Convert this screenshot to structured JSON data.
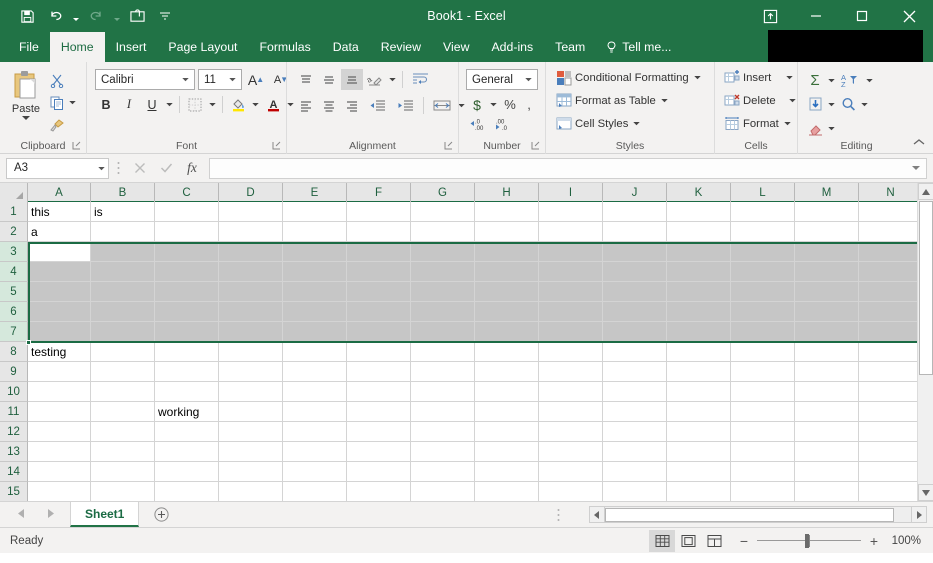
{
  "window": {
    "title": "Book1 - Excel",
    "controls": {
      "ribbon_display_options": "ribbon-display-options",
      "minimize": "minimize",
      "maximize": "maximize",
      "close": "close"
    }
  },
  "quick_access": {
    "items": [
      {
        "name": "save",
        "icon": "save-icon"
      },
      {
        "name": "undo",
        "icon": "undo-icon",
        "has_caret": true
      },
      {
        "name": "redo",
        "icon": "redo-icon",
        "has_caret": true,
        "disabled": true
      },
      {
        "name": "touch-mode",
        "icon": "touch-mode-icon"
      },
      {
        "name": "customize-quick-access-toolbar",
        "icon": "chevron-down-icon"
      }
    ]
  },
  "ribbon": {
    "tabs": [
      {
        "label": "File",
        "active": false
      },
      {
        "label": "Home",
        "active": true
      },
      {
        "label": "Insert",
        "active": false
      },
      {
        "label": "Page Layout",
        "active": false
      },
      {
        "label": "Formulas",
        "active": false
      },
      {
        "label": "Data",
        "active": false
      },
      {
        "label": "Review",
        "active": false
      },
      {
        "label": "View",
        "active": false
      },
      {
        "label": "Add-ins",
        "active": false
      },
      {
        "label": "Team",
        "active": false
      }
    ],
    "tell_me": "Tell me...",
    "groups": {
      "clipboard": {
        "label": "Clipboard",
        "paste_label": "Paste",
        "cut_label": "Cut",
        "copy_label": "Copy",
        "format_painter_label": "Format Painter"
      },
      "font": {
        "label": "Font",
        "font_name": "Calibri",
        "font_size": "11",
        "bold": "B",
        "italic": "I",
        "underline": "U",
        "increase_size": "A",
        "decrease_size": "A"
      },
      "alignment": {
        "label": "Alignment"
      },
      "number": {
        "label": "Number",
        "format": "General",
        "currency": "$",
        "percent": "%",
        "comma": ","
      },
      "styles": {
        "label": "Styles",
        "items": [
          {
            "label": "Conditional Formatting"
          },
          {
            "label": "Format as Table"
          },
          {
            "label": "Cell Styles"
          }
        ]
      },
      "cells": {
        "label": "Cells",
        "items": [
          {
            "label": "Insert"
          },
          {
            "label": "Delete"
          },
          {
            "label": "Format"
          }
        ]
      },
      "editing": {
        "label": "Editing",
        "autosum": "Σ",
        "fill": "fill-icon",
        "clear": "clear-icon",
        "sort_filter": "sort-filter-icon",
        "find_select": "find-select-icon"
      }
    }
  },
  "formula_bar": {
    "name_box_value": "A3",
    "cancel": "✕",
    "enter": "✓",
    "insert_function": "fx",
    "value": "",
    "placeholder": ""
  },
  "grid": {
    "columns": [
      {
        "label": "A",
        "width": 63
      },
      {
        "label": "B",
        "width": 64
      },
      {
        "label": "C",
        "width": 64
      },
      {
        "label": "D",
        "width": 64
      },
      {
        "label": "E",
        "width": 64
      },
      {
        "label": "F",
        "width": 64
      },
      {
        "label": "G",
        "width": 64
      },
      {
        "label": "H",
        "width": 64
      },
      {
        "label": "I",
        "width": 64
      },
      {
        "label": "J",
        "width": 64
      },
      {
        "label": "K",
        "width": 64
      },
      {
        "label": "L",
        "width": 64
      },
      {
        "label": "M",
        "width": 64
      },
      {
        "label": "N",
        "width": 64
      }
    ],
    "rows": [
      {
        "label": "1",
        "selected": false,
        "cells": {
          "A": "this",
          "B": "is"
        }
      },
      {
        "label": "2",
        "selected": false,
        "cells": {
          "A": "a"
        }
      },
      {
        "label": "3",
        "selected": true,
        "cells": {}
      },
      {
        "label": "4",
        "selected": true,
        "cells": {}
      },
      {
        "label": "5",
        "selected": true,
        "cells": {}
      },
      {
        "label": "6",
        "selected": true,
        "cells": {}
      },
      {
        "label": "7",
        "selected": true,
        "cells": {}
      },
      {
        "label": "8",
        "selected": false,
        "cells": {
          "A": "testing"
        }
      },
      {
        "label": "9",
        "selected": false,
        "cells": {}
      },
      {
        "label": "10",
        "selected": false,
        "cells": {}
      },
      {
        "label": "11",
        "selected": false,
        "cells": {
          "C": "working"
        }
      },
      {
        "label": "12",
        "selected": false,
        "cells": {}
      },
      {
        "label": "13",
        "selected": false,
        "cells": {}
      },
      {
        "label": "14",
        "selected": false,
        "cells": {}
      },
      {
        "label": "15",
        "selected": false,
        "cells": {}
      }
    ],
    "active_cell": "A3",
    "selection_range": "3:7"
  },
  "sheet_tabs": {
    "tabs": [
      {
        "label": "Sheet1",
        "active": true
      }
    ],
    "add_sheet": "+",
    "prev": "◂",
    "next": "▸"
  },
  "status_bar": {
    "status": "Ready",
    "views": [
      {
        "name": "normal-view",
        "active": true
      },
      {
        "name": "page-layout-view",
        "active": false
      },
      {
        "name": "page-break-preview",
        "active": false
      }
    ],
    "zoom_out": "−",
    "zoom_in": "+",
    "zoom_level": "100%"
  },
  "colors": {
    "brand_green": "#217346",
    "tab_active_bg": "#f3f2f1",
    "selection_gray": "#c6c6c6",
    "header_gray": "#e6e6e6",
    "selected_header": "#d5e8dc"
  }
}
